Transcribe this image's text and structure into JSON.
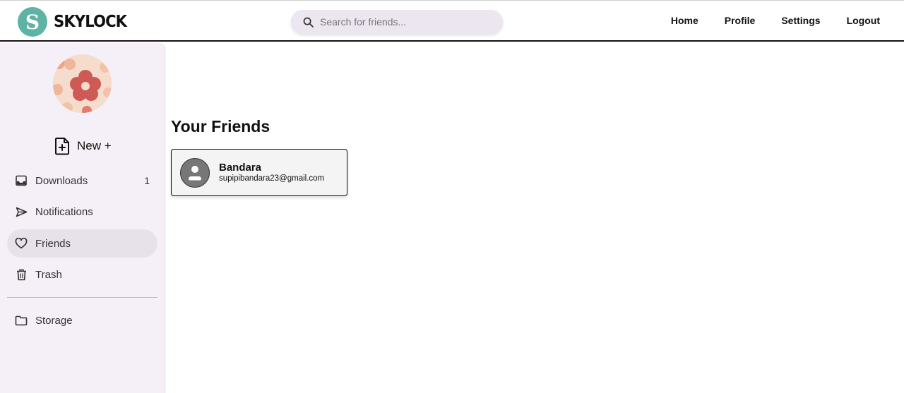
{
  "brand": {
    "initial": "S",
    "name": "SKYLOCK",
    "mark_color": "#5fb3a5"
  },
  "search": {
    "placeholder": "Search for friends...",
    "value": "",
    "icon": "search-icon"
  },
  "nav": [
    {
      "label": "Home"
    },
    {
      "label": "Profile"
    },
    {
      "label": "Settings"
    },
    {
      "label": "Logout"
    }
  ],
  "sidebar": {
    "new_button": {
      "label": "New +",
      "icon": "file-plus-icon"
    },
    "items": [
      {
        "label": "Downloads",
        "icon": "inbox-icon",
        "count": "1",
        "active": false
      },
      {
        "label": "Notifications",
        "icon": "send-icon",
        "count": "",
        "active": false
      },
      {
        "label": "Friends",
        "icon": "heart-icon",
        "count": "",
        "active": true
      },
      {
        "label": "Trash",
        "icon": "trash-icon",
        "count": "",
        "active": false
      },
      {
        "label": "Storage",
        "icon": "folder-icon",
        "count": "",
        "active": false
      }
    ]
  },
  "main": {
    "title": "Your Friends",
    "friends": [
      {
        "name": "Bandara",
        "email": "supipibandara23@gmail.com",
        "avatar_icon": "user-avatar-icon"
      }
    ]
  },
  "colors": {
    "sidebar_bg": "#f5f0f7",
    "active_item_bg": "#e7e2ea",
    "search_bg": "#ebe6ef"
  }
}
